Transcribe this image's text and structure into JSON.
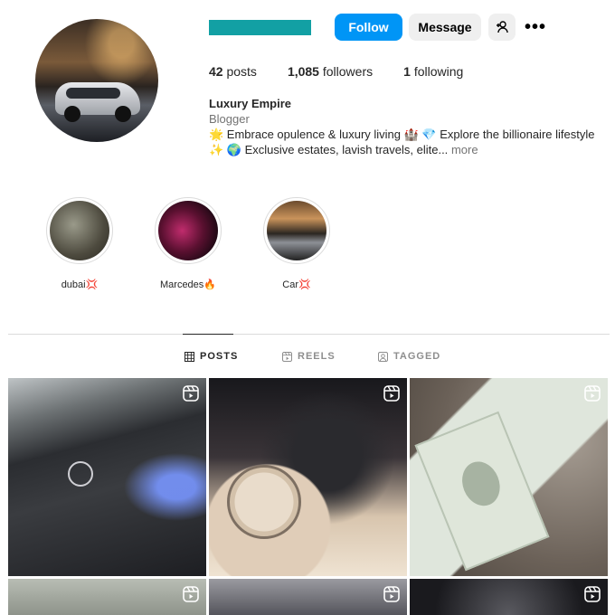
{
  "profile": {
    "follow_label": "Follow",
    "message_label": "Message",
    "suggest_icon": "add-person-icon",
    "more_icon": "more-options-icon",
    "more_symbol": "•••",
    "stats": {
      "posts_count": "42",
      "posts_label": "posts",
      "followers_count": "1,085",
      "followers_label": "followers",
      "following_count": "1",
      "following_label": "following"
    },
    "name": "Luxury Empire",
    "category": "Blogger",
    "bio_line1": "🌟 Embrace opulence & luxury living 🏰 💎 Explore the billionaire lifestyle",
    "bio_line2": "✨ 🌍 Exclusive estates, lavish travels, elite...",
    "bio_more": "more"
  },
  "highlights": [
    {
      "label": "dubai💢"
    },
    {
      "label": "Marcedes🔥"
    },
    {
      "label": "Car💢"
    }
  ],
  "tabs": [
    {
      "label": "POSTS",
      "icon": "grid-icon",
      "active": true
    },
    {
      "label": "REELS",
      "icon": "reels-icon",
      "active": false
    },
    {
      "label": "TAGGED",
      "icon": "tagged-icon",
      "active": false
    }
  ],
  "colors": {
    "accent": "#0095f6",
    "username_redaction": "#12a0a4"
  }
}
